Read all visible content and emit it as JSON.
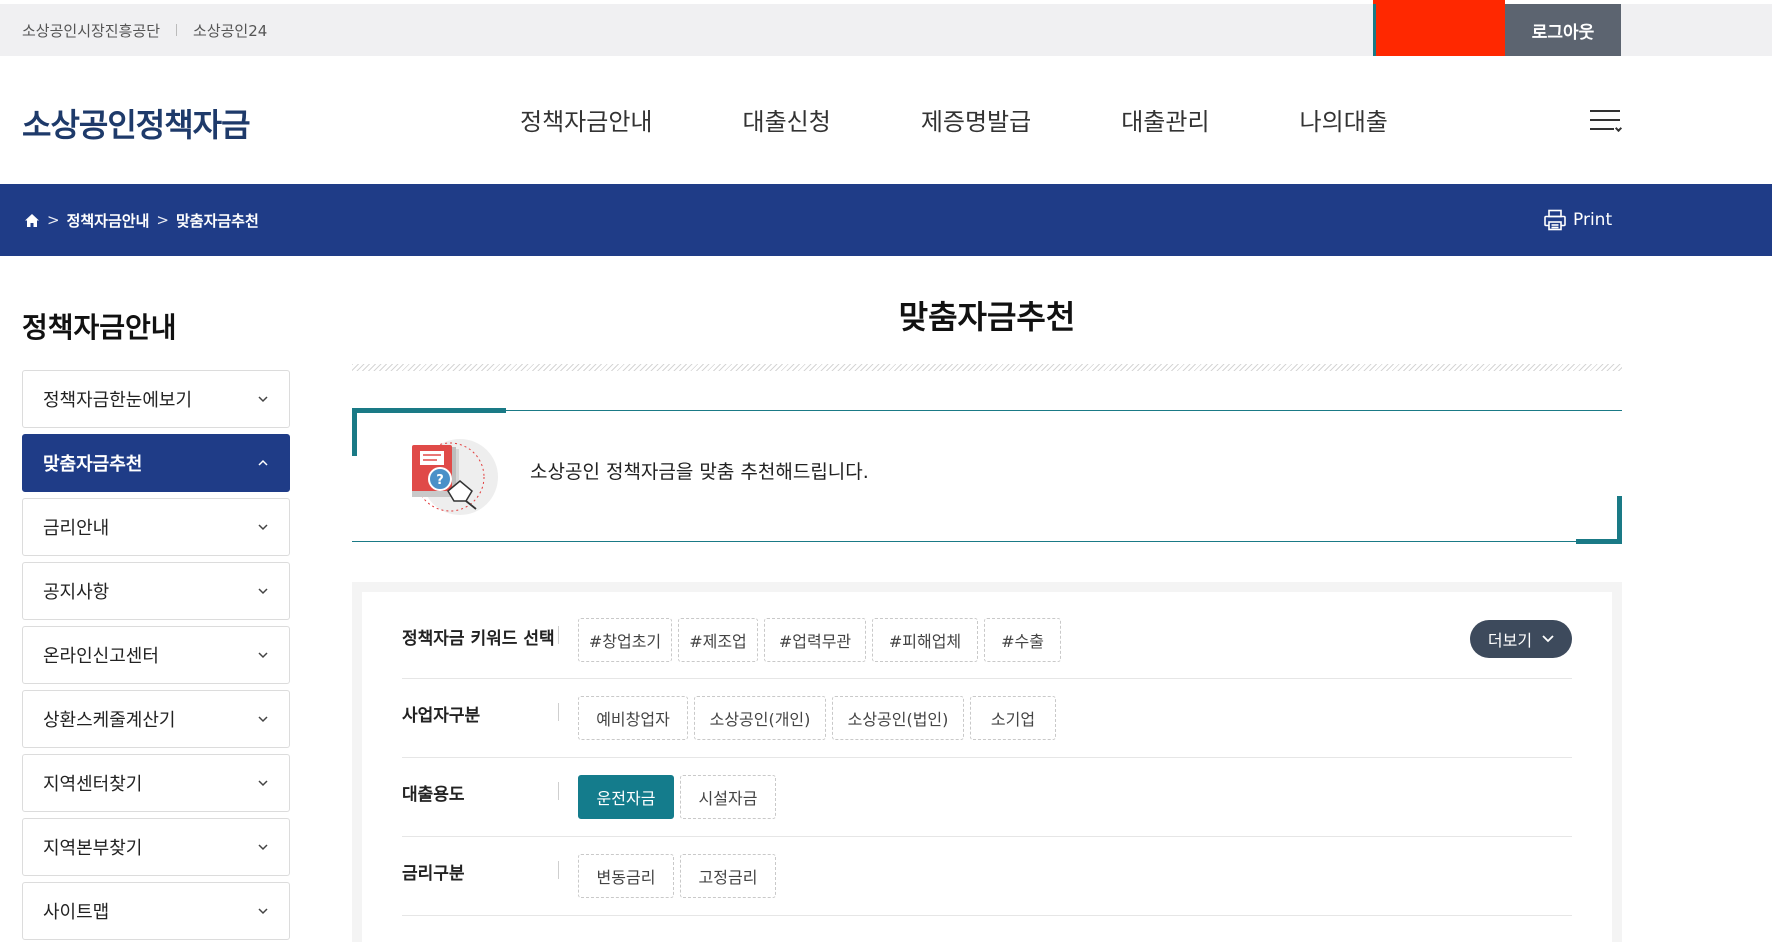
{
  "util": {
    "links": [
      "소상공인시장진흥공단",
      "소상공인24"
    ],
    "logout_label": "로그아웃"
  },
  "header": {
    "logo": "소상공인정책자금",
    "nav": [
      "정책자금안내",
      "대출신청",
      "제증명발급",
      "대출관리",
      "나의대출"
    ],
    "menu_icon": "hamburger-menu-icon"
  },
  "breadcrumb": {
    "home_icon": "home-icon",
    "items": [
      "정책자금안내",
      "맞춤자금추천"
    ],
    "print_label": "Print"
  },
  "sidebar": {
    "title": "정책자금안내",
    "items": [
      {
        "label": "정책자금한눈에보기",
        "active": false
      },
      {
        "label": "맞춤자금추천",
        "active": true
      },
      {
        "label": "금리안내",
        "active": false
      },
      {
        "label": "공지사항",
        "active": false
      },
      {
        "label": "온라인신고센터",
        "active": false
      },
      {
        "label": "상환스케줄계산기",
        "active": false
      },
      {
        "label": "지역센터찾기",
        "active": false
      },
      {
        "label": "지역본부찾기",
        "active": false
      },
      {
        "label": "사이트맵",
        "active": false
      }
    ]
  },
  "main": {
    "title": "맞춤자금추천",
    "intro_text": "소상공인 정책자금을 맞춤 추천해드립니다.",
    "filters": [
      {
        "label": "정책자금 키워드 선택",
        "options": [
          "#창업초기",
          "#제조업",
          "#업력무관",
          "#피해업체",
          "#수출"
        ],
        "selected": []
      },
      {
        "label": "사업자구분",
        "options": [
          "예비창업자",
          "소상공인(개인)",
          "소상공인(법인)",
          "소기업"
        ],
        "selected": []
      },
      {
        "label": "대출용도",
        "options": [
          "운전자금",
          "시설자금"
        ],
        "selected": [
          "운전자금"
        ]
      },
      {
        "label": "금리구분",
        "options": [
          "변동금리",
          "고정금리"
        ],
        "selected": []
      }
    ],
    "more_label": "더보기"
  },
  "colors": {
    "navy": "#1f3c87",
    "teal": "#147c8c",
    "logout_bg": "#5c6470",
    "redaction": "#ff2800"
  }
}
